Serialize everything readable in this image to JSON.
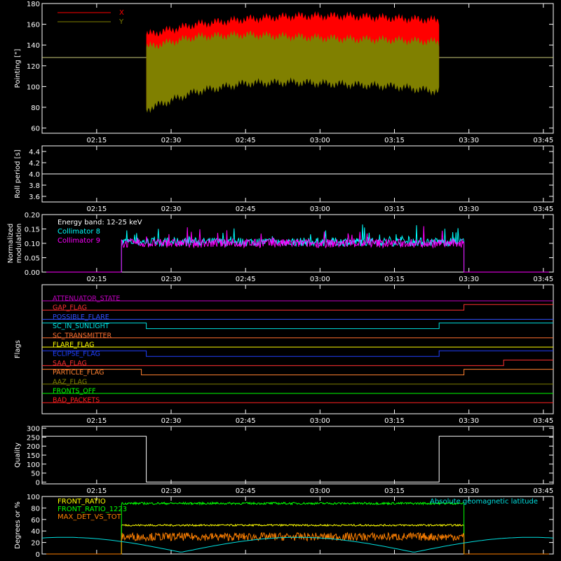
{
  "x_axis": {
    "range": [
      "02:04",
      "03:47"
    ],
    "tick_labels": [
      "02:15",
      "02:30",
      "02:45",
      "03:00",
      "03:15",
      "03:30",
      "03:45"
    ],
    "tick_minutes": [
      135,
      150,
      165,
      180,
      195,
      210,
      225
    ]
  },
  "chart_data": [
    {
      "type": "area",
      "ylabel": "Pointing [\"]",
      "ylim": [
        55,
        180
      ],
      "ytick_labels": [
        "60",
        "80",
        "100",
        "120",
        "140",
        "160",
        "180"
      ],
      "legend": [
        "X",
        "Y"
      ],
      "legend_placement": "top-left",
      "baseline": 128,
      "series": [
        {
          "name": "X",
          "color": "#ff0000",
          "x": [
            "02:25",
            "02:35",
            "02:45",
            "02:55",
            "03:05",
            "03:15",
            "03:24"
          ],
          "low": [
            80,
            108,
            118,
            120,
            122,
            122,
            122
          ],
          "high": [
            150,
            160,
            165,
            168,
            168,
            166,
            164
          ]
        },
        {
          "name": "Y",
          "color": "#808000",
          "x": [
            "02:25",
            "02:35",
            "02:45",
            "02:55",
            "03:05",
            "03:15",
            "03:24"
          ],
          "low": [
            78,
            95,
            103,
            104,
            102,
            100,
            95
          ],
          "high": [
            138,
            148,
            150,
            148,
            146,
            145,
            143
          ]
        }
      ]
    },
    {
      "type": "line",
      "ylabel": "Roll period [s]",
      "ylim": [
        3.5,
        4.5
      ],
      "ytick_labels": [
        "3.6",
        "3.8",
        "4.0",
        "4.2",
        "4.4"
      ],
      "series": [
        {
          "x": [
            "02:04",
            "03:47"
          ],
          "values": [
            4.0,
            4.0
          ],
          "color": "#ffffff"
        }
      ]
    },
    {
      "type": "line",
      "ylabel": "Normalized modulation",
      "ylim": [
        0,
        0.2
      ],
      "ytick_labels": [
        "0.00",
        "0.05",
        "0.10",
        "0.15",
        "0.20"
      ],
      "annotations": [
        "Energy band: 12-25 keV"
      ],
      "legend_placement": "top-left",
      "active_range": [
        "02:20",
        "03:29"
      ],
      "series": [
        {
          "name": "Collimator 8",
          "color": "#00ffff",
          "mean": 0.105
        },
        {
          "name": "Collimator 9",
          "color": "#ff00ff",
          "mean": 0.1
        }
      ]
    },
    {
      "type": "line",
      "ylabel": "Flags",
      "flags": [
        {
          "name": "ATTENUATOR_STATE",
          "color": "#c000c0",
          "high": []
        },
        {
          "name": "GAP_FLAG",
          "color": "#ff3030",
          "high": [
            [
              "03:29",
              "03:47"
            ]
          ]
        },
        {
          "name": "POSSIBLE_FLARE",
          "color": "#3050ff",
          "high": []
        },
        {
          "name": "SC_IN_SUNLIGHT",
          "color": "#00e0e0",
          "high": [
            [
              "02:04",
              "02:25"
            ],
            [
              "03:24",
              "03:47"
            ]
          ]
        },
        {
          "name": "SC_TRANSMITTER",
          "color": "#ff7030",
          "high": []
        },
        {
          "name": "FLARE_FLAG",
          "color": "#ffff00",
          "high": []
        },
        {
          "name": "ECLIPSE_FLAG",
          "color": "#2040ff",
          "high": [
            [
              "02:04",
              "02:25"
            ],
            [
              "03:24",
              "03:47"
            ]
          ]
        },
        {
          "name": "SAA_FLAG",
          "color": "#ff3030",
          "high": [
            [
              "03:37",
              "03:47"
            ]
          ]
        },
        {
          "name": "PARTICLE_FLAG",
          "color": "#ff8030",
          "high": [
            [
              "02:04",
              "02:24"
            ],
            [
              "03:29",
              "03:47"
            ]
          ]
        },
        {
          "name": "AAZ_FLAG",
          "color": "#808000",
          "high": []
        },
        {
          "name": "FRONTS_OFF",
          "color": "#00ff00",
          "high": []
        },
        {
          "name": "BAD_PACKETS",
          "color": "#ff2020",
          "high": []
        }
      ]
    },
    {
      "type": "line",
      "ylabel": "Quality",
      "ylim": [
        -10,
        310
      ],
      "ytick_labels": [
        "0",
        "50",
        "100",
        "150",
        "200",
        "250",
        "300"
      ],
      "series": [
        {
          "x": [
            "02:04",
            "02:25",
            "02:25",
            "03:24",
            "03:24",
            "03:47"
          ],
          "values": [
            255,
            255,
            0,
            0,
            255,
            255
          ],
          "color": "#ffffff"
        }
      ]
    },
    {
      "type": "line",
      "ylabel": "Degrees or %",
      "ylim": [
        0,
        100
      ],
      "ytick_labels": [
        "0",
        "20",
        "40",
        "60",
        "80",
        "100"
      ],
      "legend_placement": "top-left",
      "active_range": [
        "02:20",
        "03:29"
      ],
      "series": [
        {
          "name": "FRONT_RATIO",
          "color": "#ffff00",
          "mean": 50
        },
        {
          "name": "FRONT_RATIO_1223",
          "color": "#00ff00",
          "mean": 88
        },
        {
          "name": "MAX_DET_VS_TOT",
          "color": "#ff8000",
          "mean": 30
        },
        {
          "name": "Absolute geomagnetic latitude",
          "color": "#00e0e0"
        }
      ]
    }
  ]
}
